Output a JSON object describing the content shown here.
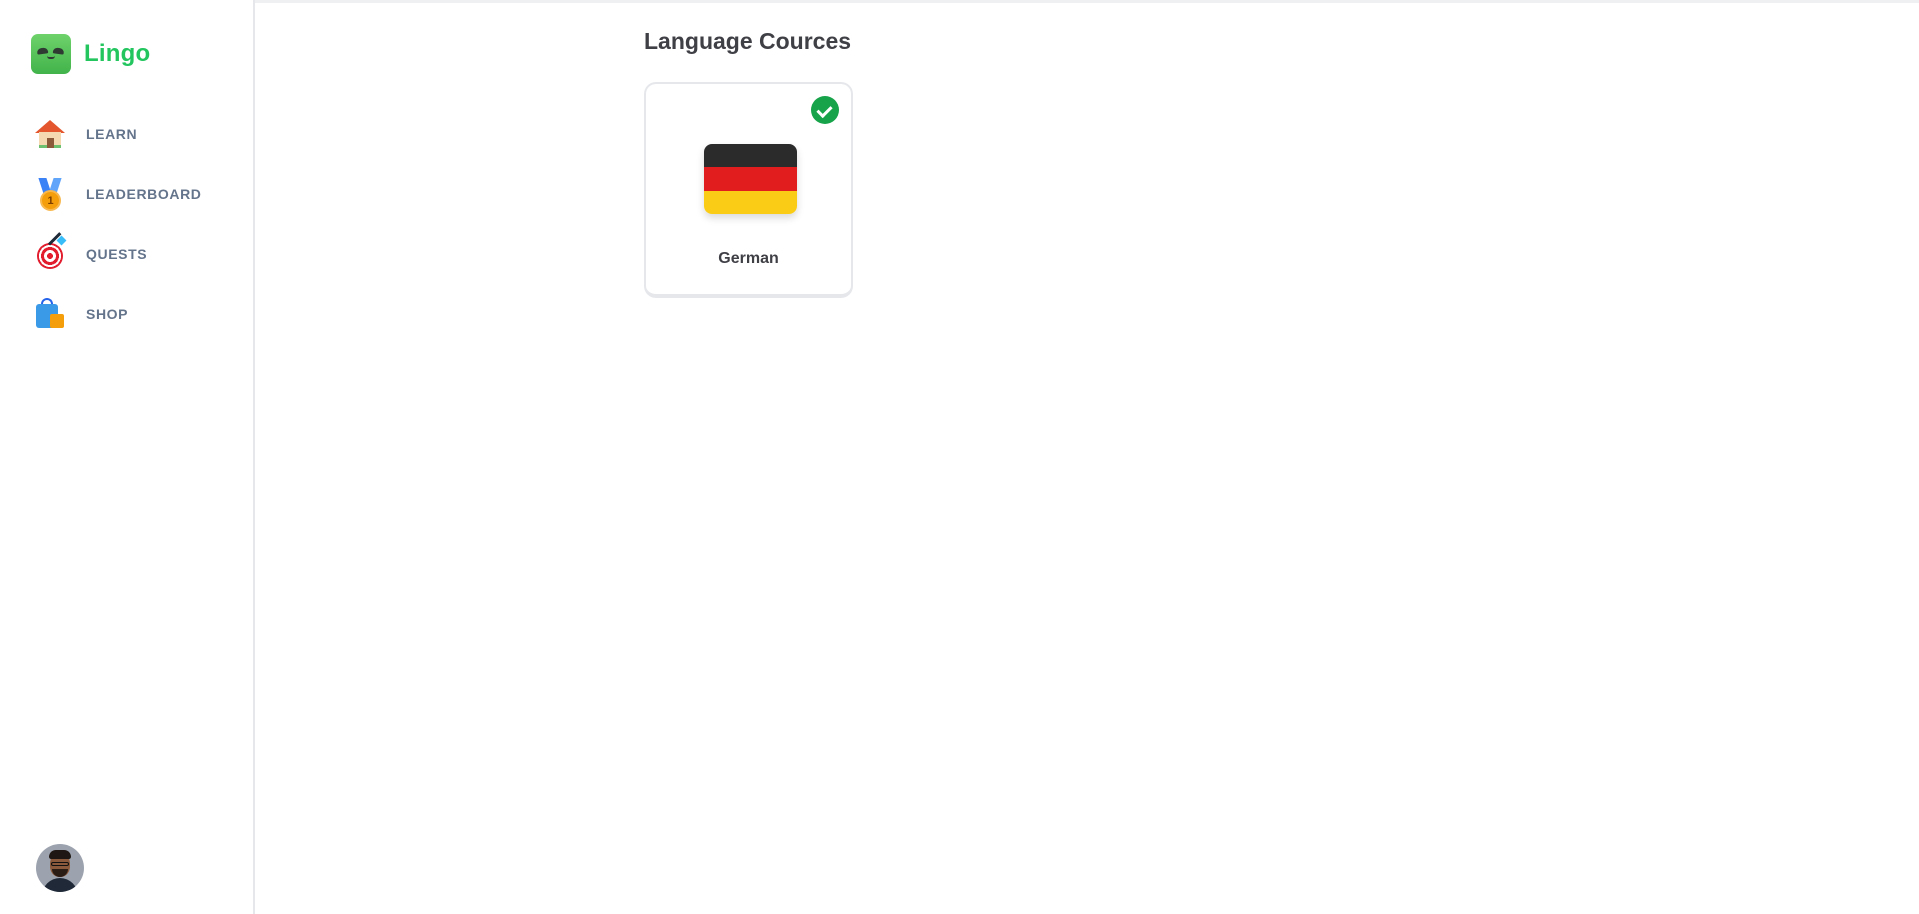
{
  "brand": {
    "name": "Lingo",
    "logo_icon": "lingo-mascot-icon",
    "accent": "#22c55e"
  },
  "sidebar": {
    "items": [
      {
        "label": "LEARN",
        "icon": "house-icon"
      },
      {
        "label": "LEADERBOARD",
        "icon": "medal-icon"
      },
      {
        "label": "QUESTS",
        "icon": "target-icon"
      },
      {
        "label": "SHOP",
        "icon": "shopping-bag-icon"
      }
    ],
    "user_avatar": "user-avatar"
  },
  "main": {
    "title": "Language Cources",
    "courses": [
      {
        "label": "German",
        "active": true,
        "flag_icon": "germany-flag-icon",
        "flag_colors": [
          "#2b2b2b",
          "#e11d1d",
          "#facc15"
        ],
        "check_color": "#16a34a"
      }
    ]
  }
}
